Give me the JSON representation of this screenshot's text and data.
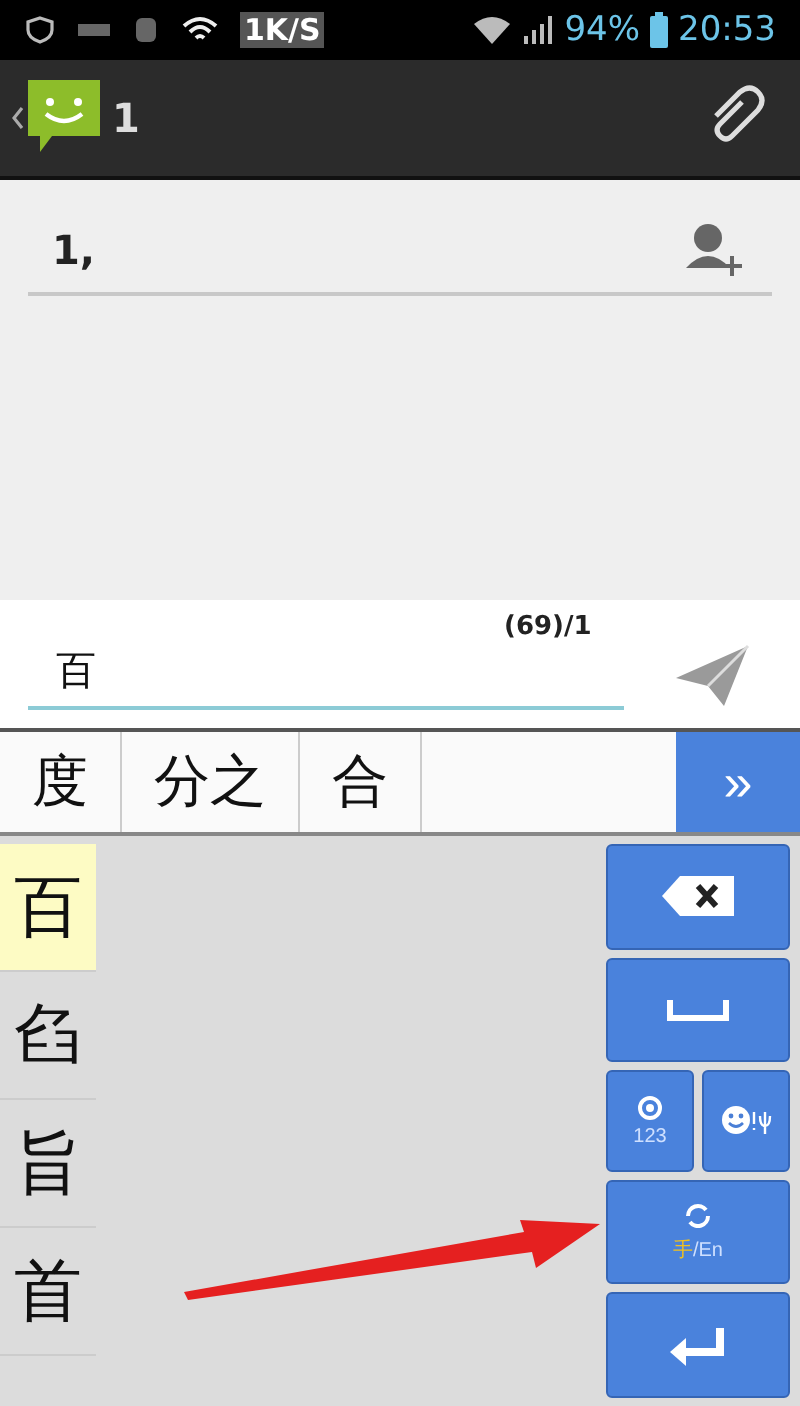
{
  "status_bar": {
    "speed": "1K/S",
    "battery": "94%",
    "time": "20:53"
  },
  "action_bar": {
    "title": "1"
  },
  "recipient": {
    "value": "1,"
  },
  "compose": {
    "value": "百",
    "counter": "(69)/1"
  },
  "suggestions": {
    "items": [
      "度",
      "分之",
      "合"
    ],
    "more": "»"
  },
  "candidates": [
    {
      "label": "百",
      "selected": true
    },
    {
      "label": "臽",
      "selected": false
    },
    {
      "label": "旨",
      "selected": false
    },
    {
      "label": "首",
      "selected": false
    }
  ],
  "keys": {
    "symbols": "123",
    "mode": {
      "separator": "/",
      "options": [
        {
          "label": "手",
          "selected": true
        },
        {
          "label": "En",
          "selected": false
        }
      ]
    }
  }
}
